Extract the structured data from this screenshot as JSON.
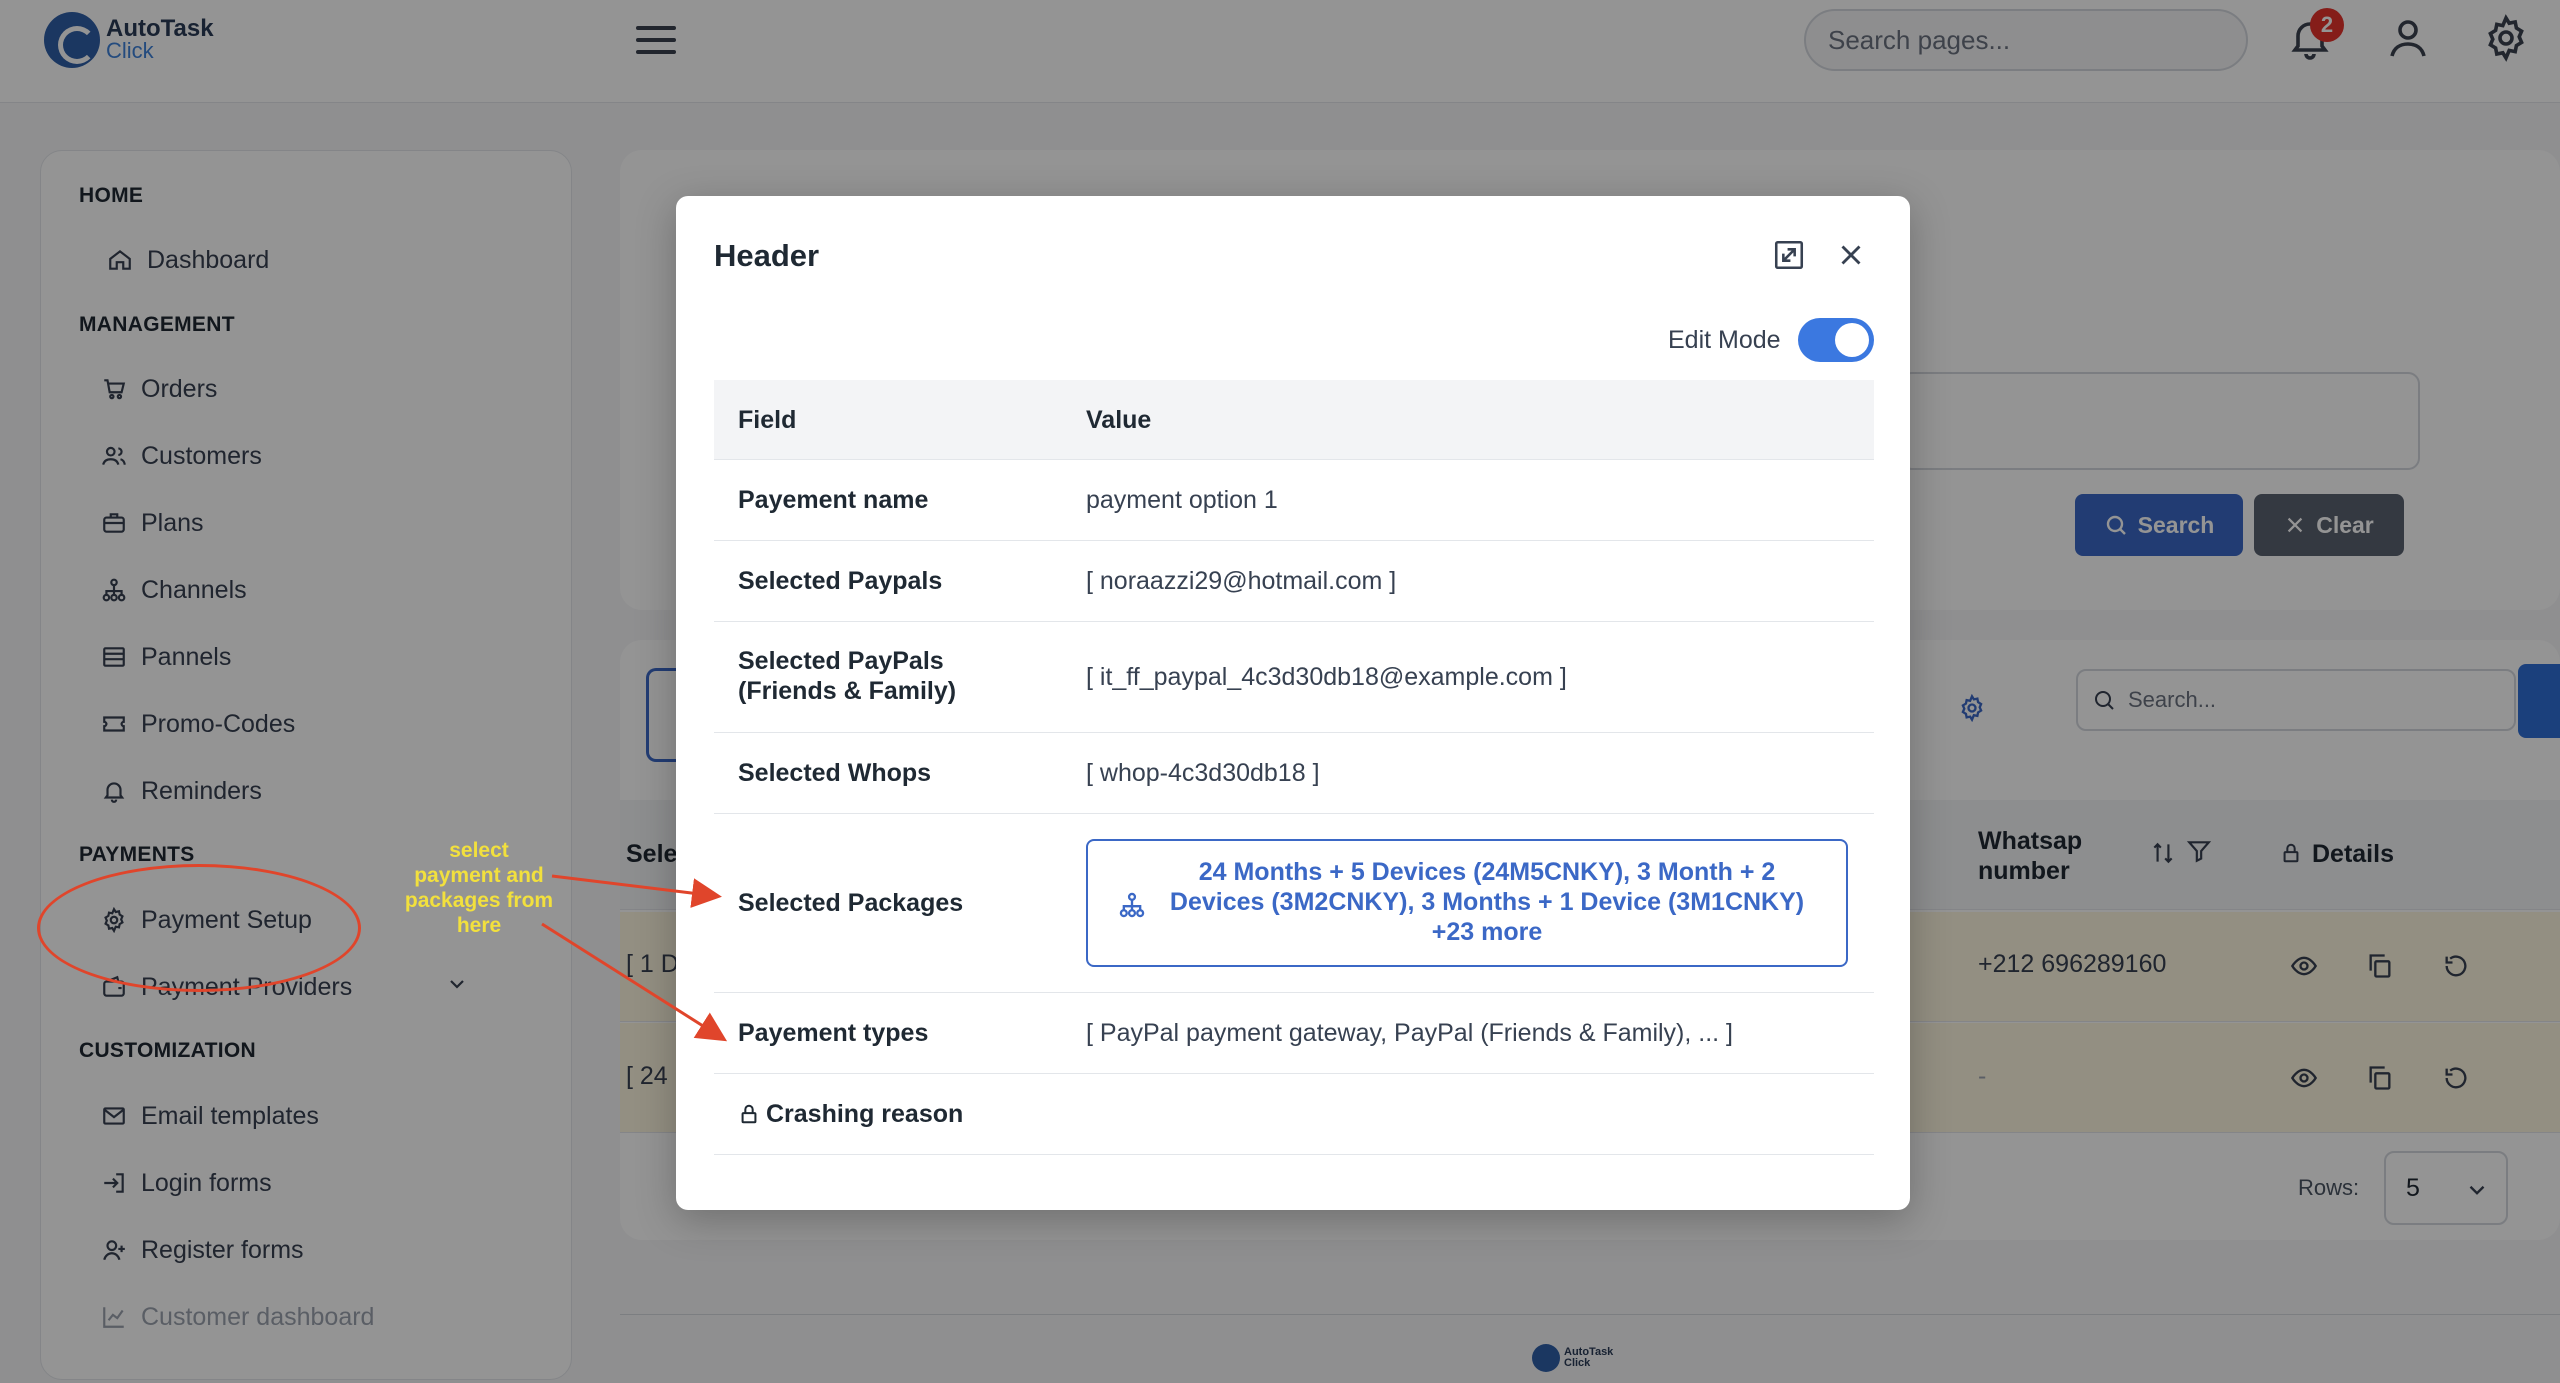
{
  "app": {
    "logo_line1": "AutoTask",
    "logo_line2": "Click"
  },
  "topbar": {
    "search_placeholder": "Search pages...",
    "notification_count": "2",
    "icons": [
      "menu-icon",
      "bell-icon",
      "user-icon",
      "gear-icon"
    ]
  },
  "sidebar": {
    "sections": [
      {
        "title": "HOME",
        "items": [
          {
            "label": "Dashboard",
            "icon": "home-icon"
          }
        ]
      },
      {
        "title": "MANAGEMENT",
        "items": [
          {
            "label": "Orders",
            "icon": "cart-icon"
          },
          {
            "label": "Customers",
            "icon": "users-icon"
          },
          {
            "label": "Plans",
            "icon": "briefcase-icon"
          },
          {
            "label": "Channels",
            "icon": "network-icon"
          },
          {
            "label": "Pannels",
            "icon": "panel-icon"
          },
          {
            "label": "Promo-Codes",
            "icon": "ticket-icon"
          },
          {
            "label": "Reminders",
            "icon": "bell-icon"
          }
        ]
      },
      {
        "title": "PAYMENTS",
        "items": [
          {
            "label": "Payment Setup",
            "icon": "gear-icon"
          },
          {
            "label": "Payment Providers",
            "icon": "wallet-icon"
          }
        ]
      },
      {
        "title": "CUSTOMIZATION",
        "items": [
          {
            "label": "Email templates",
            "icon": "mail-icon"
          },
          {
            "label": "Login forms",
            "icon": "login-icon"
          },
          {
            "label": "Register forms",
            "icon": "user-plus-icon"
          },
          {
            "label": "Customer dashboard",
            "icon": "chart-icon"
          }
        ]
      }
    ]
  },
  "filters": {
    "search_label": "Search",
    "clear_label": "Clear"
  },
  "table": {
    "search_placeholder": "Search...",
    "col_select_partial": "Sele",
    "col_whatsapp": "Whatsap number",
    "col_details": "Details",
    "rows": [
      {
        "select_partial": "[ 1 D",
        "whatsapp": "+212 696289160"
      },
      {
        "select_partial": "[ 24",
        "whatsapp": "-"
      }
    ],
    "rows_label": "Rows:",
    "rows_value": "5"
  },
  "modal": {
    "title": "Header",
    "edit_mode_label": "Edit Mode",
    "edit_mode_on": true,
    "col_field": "Field",
    "col_value": "Value",
    "fields": {
      "payment_name": {
        "label": "Payement name",
        "value": "payment option 1"
      },
      "paypals": {
        "label": "Selected Paypals",
        "value": "[ noraazzi29@hotmail.com ]"
      },
      "paypals_ff": {
        "label_1": "Selected PayPals",
        "label_2": "(Friends & Family)",
        "value": "[ it_ff_paypal_4c3d30db18@example.com ]"
      },
      "whops": {
        "label": "Selected Whops",
        "value": "[ whop-4c3d30db18 ]"
      },
      "packages": {
        "label": "Selected Packages",
        "value": "24 Months + 5 Devices (24M5CNKY), 3 Month + 2 Devices (3M2CNKY), 3 Months + 1 Device (3M1CNKY) +23 more"
      },
      "payment_types": {
        "label": "Payement types",
        "value": "[ PayPal payment gateway, PayPal (Friends & Family), ... ]"
      },
      "crashing_reason": {
        "label": "Crashing reason",
        "value": ""
      }
    }
  },
  "annotation": {
    "note": "select payment and packages from here",
    "color": "#e0452b",
    "note_color": "#f2e03d"
  },
  "colors": {
    "primary": "#3b68c6",
    "toggle": "#3b78e0",
    "row_highlight": "#fdf7e1",
    "badge": "#e5322b"
  }
}
